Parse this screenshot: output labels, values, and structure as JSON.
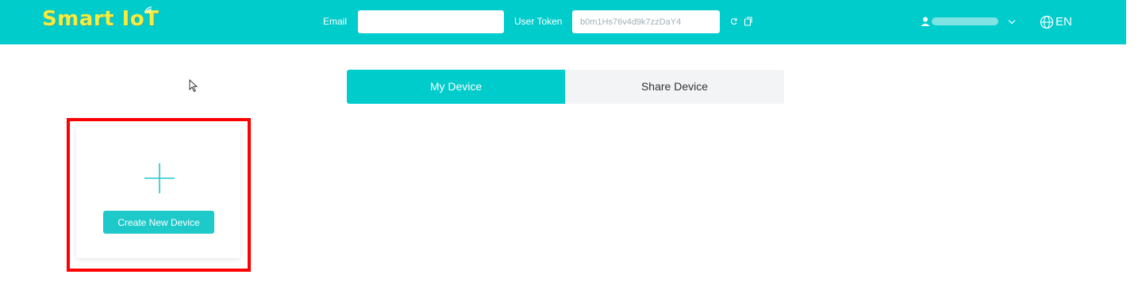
{
  "brand": {
    "name": "Smart IoT",
    "logo_color": "#f7ec3c",
    "accent_color": "#00cccc"
  },
  "header": {
    "email_label": "Email",
    "email_value": "",
    "token_label": "User Token",
    "token_value": "b0m1Hs76v4d9k7zzDaY4",
    "language": "EN",
    "icons": [
      "refresh-icon",
      "copy-icon",
      "user-icon",
      "chevron-down-icon",
      "globe-icon"
    ]
  },
  "tabs": [
    {
      "label": "My Device",
      "active": true
    },
    {
      "label": "Share Device",
      "active": false
    }
  ],
  "device_card": {
    "icon": "plus-icon",
    "button_label": "Create New Device"
  }
}
